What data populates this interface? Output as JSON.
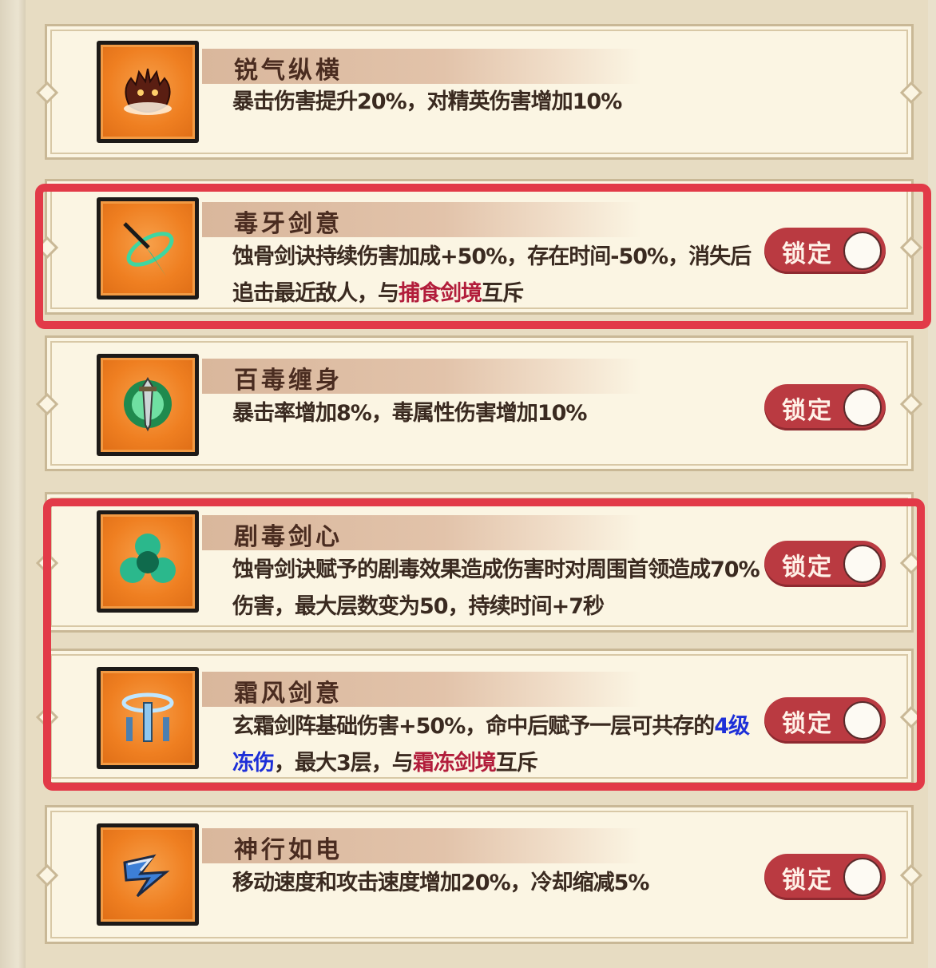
{
  "cards": [
    {
      "title": "锐气纵横",
      "desc_parts": [
        "暴击伤害提升20%，对精英伤害增加10%"
      ],
      "icon": "demon-head-icon",
      "has_toggle": false
    },
    {
      "title": "毒牙剑意",
      "desc_a": "蚀骨剑诀持续伤害加成+50%，存在时间-50%，消失后追击最近敌人，与",
      "desc_link": "捕食剑境",
      "desc_b": "互斥",
      "icon": "poison-fang-sword-icon",
      "toggle_label": "锁定"
    },
    {
      "title": "百毒缠身",
      "desc_a": "暴击率增加8%，毒属性伤害增加10%",
      "icon": "toxic-blade-icon",
      "toggle_label": "锁定"
    },
    {
      "title": "剧毒剑心",
      "desc_a": "蚀骨剑诀赋予的剧毒效果造成伤害时对周围首领造成70%伤害，最大层数变为50，持续时间+7秒",
      "icon": "toxic-orb-icon",
      "toggle_label": "锁定"
    },
    {
      "title": "霜风剑意",
      "desc_a": "玄霜剑阵基础伤害+50%，命中后赋予一层可共存的",
      "desc_blue": "4级冻伤",
      "desc_b": "，最大3层，与",
      "desc_link": "霜冻剑境",
      "desc_c": "互斥",
      "icon": "frost-swords-icon",
      "toggle_label": "锁定"
    },
    {
      "title": "神行如电",
      "desc_a": "移动速度和攻击速度增加20%，冷却缩减5%",
      "icon": "lightning-arrow-icon",
      "toggle_label": "锁定"
    }
  ],
  "colors": {
    "highlight_red": "#b21d3b",
    "highlight_blue": "#1d2fd8",
    "toggle_bg": "#ba3a41",
    "annotation_box": "#e23a48"
  }
}
